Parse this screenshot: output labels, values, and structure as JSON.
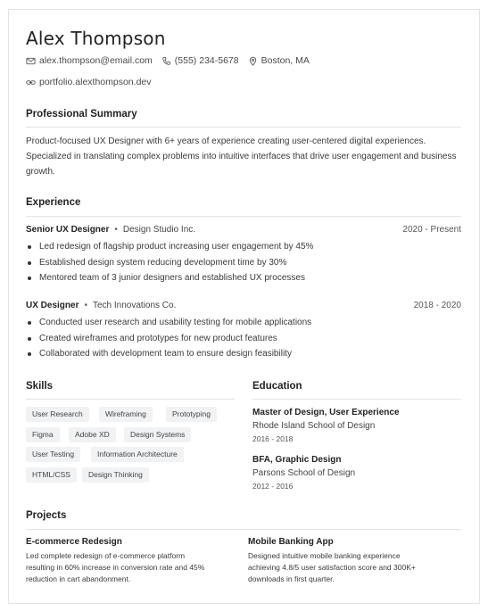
{
  "header": {
    "name": "Alex Thompson",
    "email": "alex.thompson@email.com",
    "phone": "(555) 234-5678",
    "location": "Boston, MA",
    "portfolio": "portfolio.alexthompson.dev"
  },
  "summary": {
    "title": "Professional Summary",
    "text": "Product-focused UX Designer with 6+ years of experience creating user-centered digital experiences. Specialized in translating complex problems into intuitive interfaces that drive user engagement and business growth."
  },
  "experience": {
    "title": "Experience",
    "jobs": [
      {
        "title": "Senior UX Designer",
        "company": "Design Studio Inc.",
        "dates": "2020 - Present",
        "bullets": [
          "Led redesign of flagship product increasing user engagement by 45%",
          "Established design system reducing development time by 30%",
          "Mentored team of 3 junior designers and established UX processes"
        ]
      },
      {
        "title": "UX Designer",
        "company": "Tech Innovations Co.",
        "dates": "2018 - 2020",
        "bullets": [
          "Conducted user research and usability testing for mobile applications",
          "Created wireframes and prototypes for new product features",
          "Collaborated with development team to ensure design feasibility"
        ]
      }
    ]
  },
  "skills": {
    "title": "Skills",
    "items": [
      "User Research",
      "Wireframing",
      "Prototyping",
      "Figma",
      "Adobe XD",
      "Design Systems",
      "User Testing",
      "Information Architecture",
      "HTML/CSS",
      "Design Thinking"
    ]
  },
  "education": {
    "title": "Education",
    "entries": [
      {
        "degree": "Master of Design, User Experience",
        "school": "Rhode Island School of Design",
        "years": "2016 - 2018"
      },
      {
        "degree": "BFA, Graphic Design",
        "school": "Parsons School of Design",
        "years": "2012 - 2016"
      }
    ]
  },
  "projects": {
    "title": "Projects",
    "items": [
      {
        "title": "E-commerce Redesign",
        "desc_lines": [
          "Led complete redesign of e-commerce platform",
          "resulting in 60% increase in conversion rate and 45%",
          "reduction in cart abandonment."
        ]
      },
      {
        "title": "Mobile Banking App",
        "desc_lines": [
          "Designed intuitive mobile banking experience",
          "achieving 4.8/5 user satisfaction score and 300K+",
          "downloads in first quarter."
        ]
      }
    ]
  },
  "icons": {
    "email": "mail-icon",
    "phone": "phone-icon",
    "location": "map-pin-icon",
    "portfolio": "link-icon"
  }
}
